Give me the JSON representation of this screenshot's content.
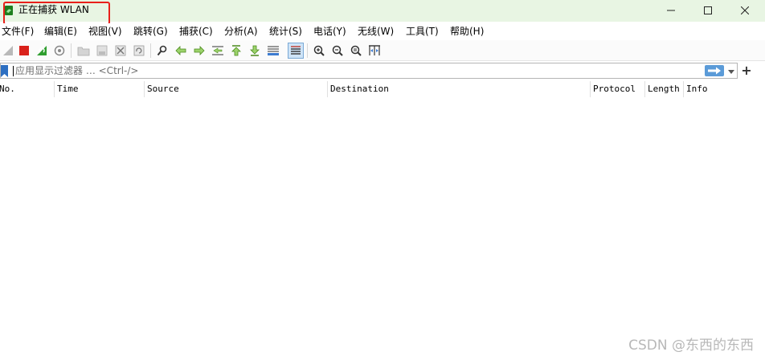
{
  "window": {
    "title": "正在捕获 WLAN",
    "controls": [
      "minimize",
      "maximize",
      "close"
    ]
  },
  "menu": [
    {
      "label": "文件(F)"
    },
    {
      "label": "编辑(E)"
    },
    {
      "label": "视图(V)"
    },
    {
      "label": "跳转(G)"
    },
    {
      "label": "捕获(C)"
    },
    {
      "label": "分析(A)"
    },
    {
      "label": "统计(S)"
    },
    {
      "label": "电话(Y)"
    },
    {
      "label": "无线(W)"
    },
    {
      "label": "工具(T)"
    },
    {
      "label": "帮助(H)"
    }
  ],
  "toolbar": {
    "buttons": [
      "start-capture-icon",
      "stop-capture-icon",
      "restart-capture-icon",
      "capture-options-icon",
      "open-file-icon",
      "save-file-icon",
      "close-file-icon",
      "reload-file-icon",
      "find-packet-icon",
      "go-back-icon",
      "go-forward-icon",
      "go-to-packet-icon",
      "first-packet-icon",
      "last-packet-icon",
      "auto-scroll-icon",
      "colorize-icon",
      "zoom-in-icon",
      "zoom-out-icon",
      "normal-size-icon",
      "resize-columns-icon"
    ]
  },
  "filter": {
    "placeholder": "应用显示过滤器 … <Ctrl-/>",
    "value": "",
    "add_label": "+"
  },
  "packet_list": {
    "columns": [
      "No.",
      "Time",
      "Source",
      "Destination",
      "Protocol",
      "Length",
      "Info"
    ],
    "rows": []
  },
  "watermark": "CSDN @东西的东西",
  "colors": {
    "title_bg": "#e8f5e3",
    "highlight_box": "#e8201a",
    "stop_red": "#d9211b",
    "shark_green": "#2f9e2f",
    "accent_blue": "#5b9bd8"
  }
}
